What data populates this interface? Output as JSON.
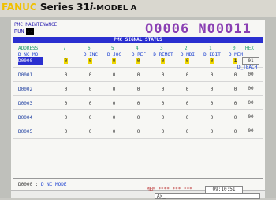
{
  "brand": {
    "name": "FANUC",
    "series": "Series 31",
    "model_i": "i",
    "model": "-MODEL A"
  },
  "screen": {
    "title": "PMC MAINTENANCE",
    "mode": "RUN",
    "mode_value": "--",
    "program": "O0006 N00011",
    "signal_bar": "PMC SIGNAL STATUS"
  },
  "columns": {
    "address": "ADDRESS",
    "name_hdr": "D_NC_MO",
    "bits": [
      "7",
      "6",
      "5",
      "4",
      "3",
      "2",
      "1",
      "0"
    ],
    "hex": "HEX",
    "bit_names": [
      "",
      "D_INC",
      "D_JOG",
      "D_REF",
      "D_REMOT",
      "D_MDI",
      "D_EDIT",
      "D_MEM"
    ],
    "extra_name": "D_TEACH"
  },
  "rows": [
    {
      "addr": "D0000",
      "bits": [
        "0",
        "0",
        "0",
        "0",
        "0",
        "0",
        "0",
        "1"
      ],
      "hex": "01"
    },
    {
      "addr": "D0001",
      "bits": [
        "0",
        "0",
        "0",
        "0",
        "0",
        "0",
        "0",
        "0"
      ],
      "hex": "00"
    },
    {
      "addr": "D0002",
      "bits": [
        "0",
        "0",
        "0",
        "0",
        "0",
        "0",
        "0",
        "0"
      ],
      "hex": "00"
    },
    {
      "addr": "D0003",
      "bits": [
        "0",
        "0",
        "0",
        "0",
        "0",
        "0",
        "0",
        "0"
      ],
      "hex": "00"
    },
    {
      "addr": "D0004",
      "bits": [
        "0",
        "0",
        "0",
        "0",
        "0",
        "0",
        "0",
        "0"
      ],
      "hex": "00"
    },
    {
      "addr": "D0005",
      "bits": [
        "0",
        "0",
        "0",
        "0",
        "0",
        "0",
        "0",
        "0"
      ],
      "hex": "00"
    }
  ],
  "footer": {
    "addr": "D0000",
    "sep": ":",
    "name": "D_NC_MODE"
  },
  "status": {
    "prompt": "A>_",
    "mem": "MEM **** *** ***",
    "time": "09:10:51"
  }
}
